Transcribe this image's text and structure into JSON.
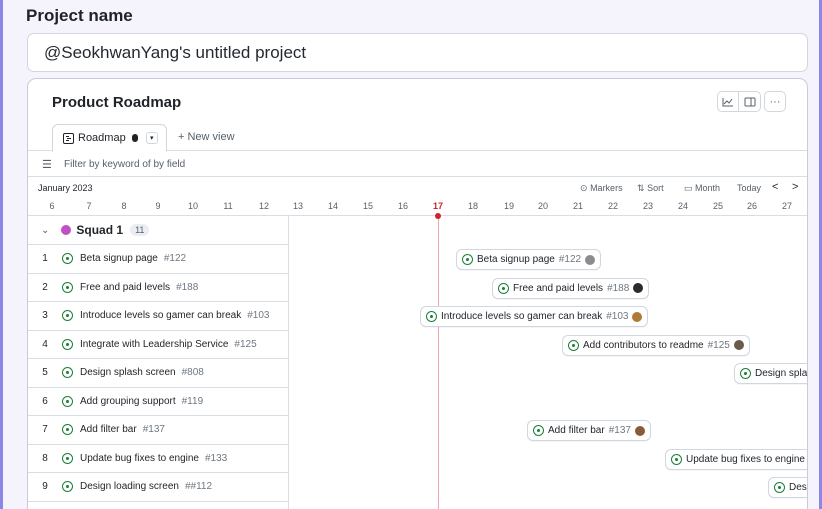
{
  "project": {
    "label": "Project name",
    "value": "@SeokhwanYang's untitled project"
  },
  "card": {
    "title": "Product Roadmap",
    "toolbar_icons": [
      "chart-icon",
      "panel-icon",
      "more-icon"
    ],
    "more_label": "···"
  },
  "tabs": {
    "active": {
      "label": "Roadmap",
      "icon": "roadmap-icon"
    },
    "new_view": "+ New view"
  },
  "filter": {
    "placeholder": "Filter by keyword of by field"
  },
  "timeline": {
    "month": "January 2023",
    "controls": {
      "markers": "Markers",
      "sort": "Sort",
      "zoom": "Month",
      "today": "Today",
      "prev": "<",
      "next": ">"
    },
    "days": [
      "6",
      "7",
      "8",
      "9",
      "10",
      "11",
      "12",
      "13",
      "14",
      "15",
      "16",
      "17",
      "18",
      "19",
      "20",
      "21",
      "22",
      "23",
      "24",
      "25",
      "26",
      "27"
    ],
    "today": "17"
  },
  "group": {
    "name": "Squad 1",
    "count": "11",
    "color": "#c14fc6"
  },
  "rows": [
    {
      "num": "1",
      "title": "Beta signup page",
      "issue": "#122"
    },
    {
      "num": "2",
      "title": "Free and paid levels",
      "issue": "#188"
    },
    {
      "num": "3",
      "title": "Introduce levels so gamer can break",
      "issue": "#103"
    },
    {
      "num": "4",
      "title": "Integrate with Leadership Service",
      "issue": "#125"
    },
    {
      "num": "5",
      "title": "Design splash screen",
      "issue": "#808"
    },
    {
      "num": "6",
      "title": "Add grouping support",
      "issue": "#119"
    },
    {
      "num": "7",
      "title": "Add filter bar",
      "issue": "#137"
    },
    {
      "num": "8",
      "title": "Update bug fixes to engine",
      "issue": "#133"
    },
    {
      "num": "9",
      "title": "Design loading screen",
      "issue": "##112"
    }
  ],
  "bars": [
    {
      "title": "Beta signup page",
      "issue": "#122",
      "avatar": "#8c8c8c"
    },
    {
      "title": "Free and paid levels",
      "issue": "#188",
      "avatar": "#2b2b2b"
    },
    {
      "title": "Introduce levels so gamer can break",
      "issue": "#103",
      "avatar": "#b07a3a"
    },
    {
      "title": "Add contributors to readme",
      "issue": "#125",
      "avatar": "#6b5a4a"
    },
    {
      "title": "Design spla",
      "issue": "",
      "avatar": ""
    },
    {
      "title": "Add filter bar",
      "issue": "#137",
      "avatar": "#8a5a3a"
    },
    {
      "title": "Update bug fixes to engine",
      "issue": "",
      "avatar": ""
    },
    {
      "title": "Des",
      "issue": "",
      "avatar": ""
    }
  ],
  "colors": {
    "accent": "#8b87e6",
    "status_green": "#1a7f37",
    "today_red": "#cf222e"
  }
}
